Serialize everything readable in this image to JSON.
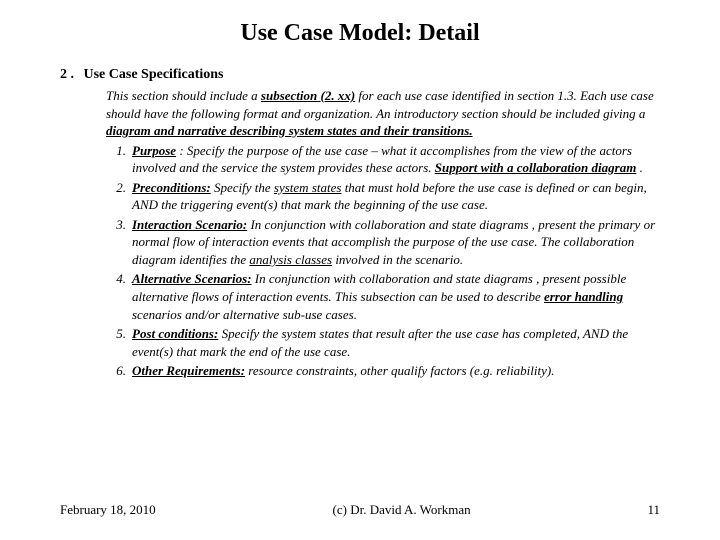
{
  "title": "Use Case Model: Detail",
  "section": {
    "number": "2 .",
    "heading": "Use Case Specifications",
    "intro_pre": "This section should include a ",
    "intro_sub": "subsection (2. xx)",
    "intro_mid": " for each use case identified in section 1.3.  Each use case should have the following format and organization. An introductory section should be included giving a ",
    "intro_diag": "diagram and narrative describing system states and their transitions."
  },
  "items": [
    {
      "n": "1.",
      "label": "Purpose",
      "sep": " :",
      "body_a": "  Specify the purpose of the use case – what it accomplishes from the view of the actors involved and the service the system provides these actors. ",
      "tail_u": "Support with a collaboration diagram",
      "tail_p": " ."
    },
    {
      "n": "2.",
      "label": "Preconditions:",
      "sep": "",
      "body_a": " Specify the ",
      "mid_u": "system states",
      "body_b": " that must hold before the use case is defined or can begin, AND the triggering event(s) that mark the beginning of the use case."
    },
    {
      "n": "3.",
      "label": "Interaction Scenario:",
      "sep": "",
      "body_a": " In conjunction with collaboration and state diagrams , present the primary or normal flow of interaction events that accomplish the purpose of the use case.  The collaboration diagram identifies the ",
      "mid_u": "analysis classes",
      "body_b": " involved in the scenario."
    },
    {
      "n": "4.",
      "label": "Alternative Scenarios:",
      "sep": "",
      "body_a": " In conjunction with collaboration and state diagrams , present possible alternative flows of interaction events.  This subsection can be used to describe ",
      "mid_u": "error handling",
      "body_b": " scenarios and/or alternative sub-use cases."
    },
    {
      "n": "5.",
      "label": "Post conditions:",
      "sep": "",
      "body_a": " Specify the system states that result after the use case has completed, AND the event(s) that mark the end of the use case."
    },
    {
      "n": "6.",
      "label": "Other Requirements:",
      "sep": "",
      "body_a": " resource constraints, other qualify factors (e.g. reliability)."
    }
  ],
  "footer": {
    "date": "February 18, 2010",
    "copyright": "(c) Dr. David A. Workman",
    "page": "11"
  }
}
